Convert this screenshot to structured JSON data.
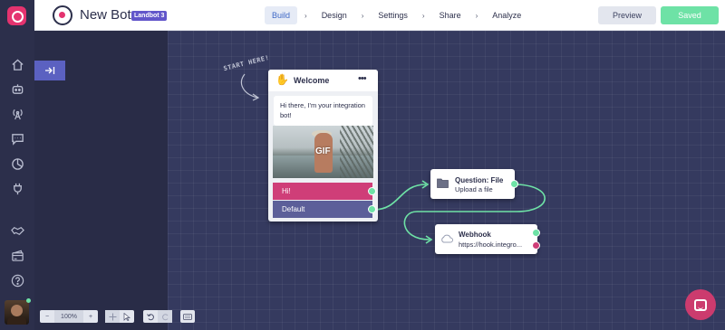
{
  "app": {
    "bot_name": "New Bot",
    "plan_badge": "Landbot 3"
  },
  "nav": {
    "tabs": [
      "Build",
      "Design",
      "Settings",
      "Share",
      "Analyze"
    ],
    "active": "Build",
    "separator": "›"
  },
  "header_actions": {
    "preview_label": "Preview",
    "saved_label": "Saved"
  },
  "sidebar": {
    "icons": [
      "home-icon",
      "bot-icon",
      "broadcast-icon",
      "chat-icon",
      "analytics-icon",
      "integrations-icon",
      "partners-icon",
      "billing-icon",
      "help-icon"
    ]
  },
  "canvas": {
    "start_label": "START HERE!",
    "welcome_node": {
      "title": "Welcome",
      "emoji_icon": "waving-hand-icon",
      "message": "Hi there, I'm your integration bot!",
      "media_label": "GIF",
      "buttons": [
        "Hi!",
        "Default"
      ]
    },
    "question_node": {
      "title": "Question: File",
      "subtitle": "Upload a file",
      "icon": "folder-icon"
    },
    "webhook_node": {
      "title": "Webhook",
      "subtitle": "https://hook.integro...",
      "icon": "cloud-icon"
    }
  },
  "zoom": {
    "minus": "−",
    "level": "100%",
    "plus": "+"
  },
  "colors": {
    "accent_pink": "#cf3e78",
    "accent_green": "#6ee2a6",
    "accent_indigo": "#5c5f99",
    "canvas_bg": "#353a5f"
  }
}
